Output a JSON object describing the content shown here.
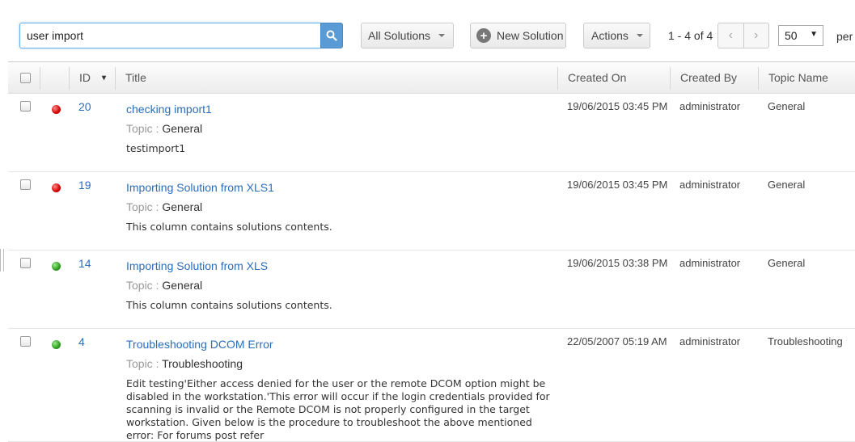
{
  "search": {
    "value": "user import"
  },
  "toolbar": {
    "solutions_filter": "All Solutions",
    "new_solution": "New Solution",
    "actions": "Actions",
    "pager_range": "1 - 4 of 4",
    "per_page_value": "50",
    "per_page_label": "per"
  },
  "table": {
    "headers": {
      "id": "ID",
      "title": "Title",
      "created_on": "Created On",
      "created_by": "Created By",
      "topic_name": "Topic Name"
    },
    "topic_label": "Topic :",
    "rows": [
      {
        "status": "red",
        "id": "20",
        "title": "checking import1",
        "topic": "General",
        "description": "testimport1",
        "created_on": "19/06/2015 03:45 PM",
        "created_by": "administrator",
        "topic_name": "General"
      },
      {
        "status": "red",
        "id": "19",
        "title": "Importing Solution from XLS1",
        "topic": "General",
        "description": "This column contains solutions contents.",
        "created_on": "19/06/2015 03:45 PM",
        "created_by": "administrator",
        "topic_name": "General"
      },
      {
        "status": "green",
        "id": "14",
        "title": "Importing Solution from XLS",
        "topic": "General",
        "description": "This column contains solutions contents.",
        "created_on": "19/06/2015 03:38 PM",
        "created_by": "administrator",
        "topic_name": "General"
      },
      {
        "status": "green",
        "id": "4",
        "title": "Troubleshooting DCOM Error",
        "topic": "Troubleshooting",
        "description": "Edit  testing'Either access denied for the user or the remote DCOM option might be disabled in the workstation.'This error will occur if the login credentials provided for scanning is invalid or the Remote DCOM is not properly configured in the target workstation. Given below is the procedure to troubleshoot the above mentioned error: For forums post refer",
        "created_on": "22/05/2007 05:19 AM",
        "created_by": "administrator",
        "topic_name": "Troubleshooting"
      }
    ]
  },
  "colors": {
    "link": "#2a6ebb",
    "status_red": "#d40000",
    "status_green": "#2e9c1e",
    "search_button": "#5b9bd5"
  }
}
